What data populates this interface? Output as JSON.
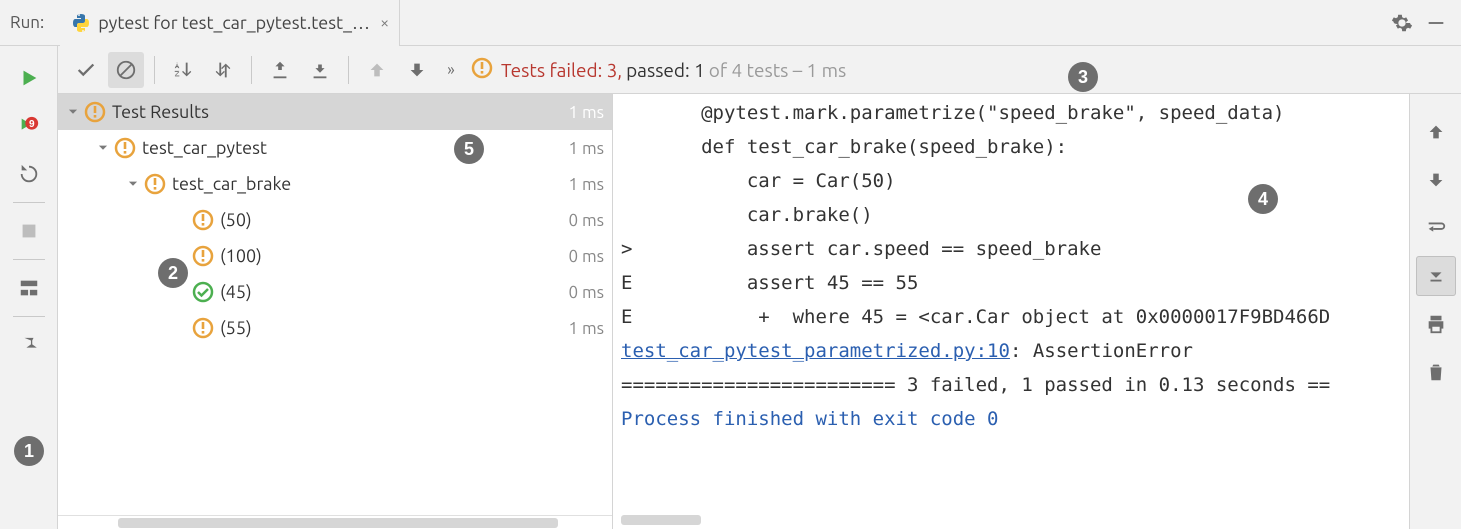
{
  "header": {
    "run_label": "Run:",
    "tab_title": "pytest for test_car_pytest.test_c..."
  },
  "summary": {
    "failed_label": "Tests failed: 3,",
    "passed_label": " passed: 1",
    "suffix": " of 4 tests – 1 ms"
  },
  "tree": {
    "root": {
      "label": "Test Results",
      "time": "1 ms",
      "status": "warn"
    },
    "suite": {
      "label": "test_car_pytest",
      "time": "1 ms",
      "status": "warn"
    },
    "test": {
      "label": "test_car_brake",
      "time": "1 ms",
      "status": "warn"
    },
    "cases": [
      {
        "label": "(50)",
        "time": "0 ms",
        "status": "warn"
      },
      {
        "label": "(100)",
        "time": "0 ms",
        "status": "warn"
      },
      {
        "label": "(45)",
        "time": "0 ms",
        "status": "pass"
      },
      {
        "label": "(55)",
        "time": "1 ms",
        "status": "warn"
      }
    ]
  },
  "console": {
    "lines": [
      {
        "cls": "",
        "text": "       @pytest.mark.parametrize(\"speed_brake\", speed_data)"
      },
      {
        "cls": "",
        "text": "       def test_car_brake(speed_brake):"
      },
      {
        "cls": "",
        "text": "           car = Car(50)"
      },
      {
        "cls": "",
        "text": "           car.brake()"
      },
      {
        "cls": "",
        "text": ">          assert car.speed == speed_brake"
      },
      {
        "cls": "",
        "text": "E          assert 45 == 55"
      },
      {
        "cls": "",
        "text": "E           +  where 45 = <car.Car object at 0x0000017F9BD466D"
      },
      {
        "cls": "",
        "text": ""
      },
      {
        "cls": "mix",
        "link": "test_car_pytest_parametrized.py:10",
        "after": ": AssertionError"
      },
      {
        "cls": "",
        "text": "======================== 3 failed, 1 passed in 0.13 seconds =="
      },
      {
        "cls": "blue",
        "text": "Process finished with exit code 0"
      }
    ]
  },
  "callouts": {
    "1": "1",
    "2": "2",
    "3": "3",
    "4": "4",
    "5": "5"
  }
}
